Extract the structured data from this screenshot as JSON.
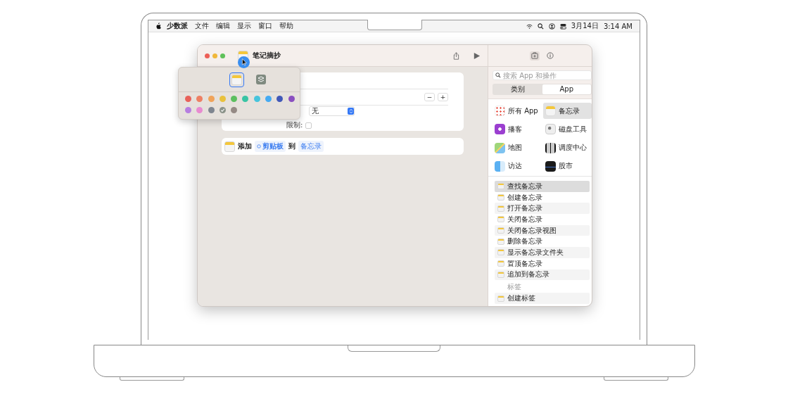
{
  "menubar": {
    "app_name": "少数派",
    "menus": [
      "文件",
      "编辑",
      "显示",
      "窗口",
      "帮助"
    ],
    "date": "3月14日",
    "time": "3:14 AM"
  },
  "window": {
    "title": "笔记摘抄"
  },
  "icon_picker": {
    "glyphs": [
      {
        "selected": true
      },
      {
        "selected": false
      }
    ],
    "colors": [
      {
        "color": "#e8615a",
        "selected": false
      },
      {
        "color": "#ee7f63",
        "selected": false
      },
      {
        "color": "#f0a35a",
        "selected": false
      },
      {
        "color": "#e9c13c",
        "selected": false
      },
      {
        "color": "#5cbf5f",
        "selected": false
      },
      {
        "color": "#38c4a4",
        "selected": false
      },
      {
        "color": "#47c4dc",
        "selected": false
      },
      {
        "color": "#45aaf2",
        "selected": false
      },
      {
        "color": "#4158b8",
        "selected": false
      },
      {
        "color": "#8a4fc0",
        "selected": false
      },
      {
        "color": "#b67ee0",
        "selected": false
      },
      {
        "color": "#e88bd0",
        "selected": false
      },
      {
        "color": "#7f8690",
        "selected": false
      },
      {
        "color": "#8a9289",
        "selected": true
      },
      {
        "color": "#958a85",
        "selected": false
      }
    ]
  },
  "settings_card": {
    "stepper": [
      "−",
      "+"
    ],
    "select_value": "无",
    "limit_label": "限制:",
    "limit_checked": false
  },
  "action_card": {
    "parts": [
      {
        "kind": "text",
        "text": "添加"
      },
      {
        "kind": "variable",
        "text": "剪贴板"
      },
      {
        "kind": "text",
        "text": "到"
      },
      {
        "kind": "token",
        "text": "备忘录"
      }
    ]
  },
  "sidebar": {
    "tabs": [
      {
        "selected": true
      },
      {
        "selected": false
      }
    ],
    "search": {
      "placeholder": "搜索 App 和操作"
    },
    "segments": [
      {
        "label": "类别",
        "selected": false
      },
      {
        "label": "App",
        "selected": true
      }
    ],
    "apps": [
      {
        "label": "所有 App",
        "selected": false
      },
      {
        "label": "备忘录",
        "selected": true
      },
      {
        "label": "播客",
        "selected": false
      },
      {
        "label": "磁盘工具",
        "selected": false
      },
      {
        "label": "地图",
        "selected": false
      },
      {
        "label": "调度中心",
        "selected": false
      },
      {
        "label": "访达",
        "selected": false
      },
      {
        "label": "股市",
        "selected": false
      }
    ],
    "actions": [
      {
        "label": "查找备忘录",
        "selected": true
      },
      {
        "label": "创建备忘录",
        "selected": false
      },
      {
        "label": "打开备忘录",
        "selected": false
      },
      {
        "label": "关闭备忘录",
        "selected": false
      },
      {
        "label": "关闭备忘录视图",
        "selected": false
      },
      {
        "label": "删除备忘录",
        "selected": false
      },
      {
        "label": "显示备忘录文件夹",
        "selected": false
      },
      {
        "label": "置顶备忘录",
        "selected": false
      },
      {
        "label": "追加到备忘录",
        "selected": false
      }
    ],
    "section": "标签",
    "section_actions": [
      {
        "label": "创建标签",
        "selected": false
      }
    ]
  }
}
